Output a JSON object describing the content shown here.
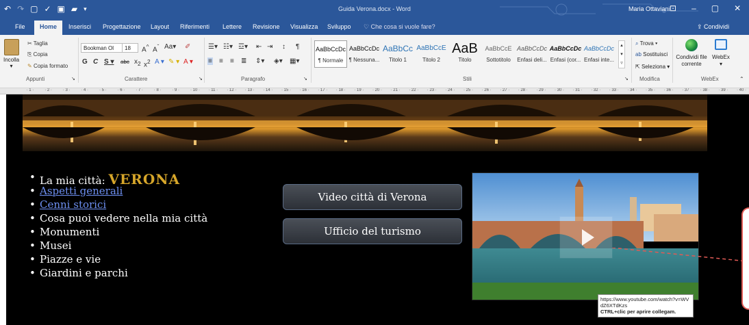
{
  "window": {
    "title": "Guida Verona.docx  -  Word",
    "user": "Maria Ottaviani"
  },
  "tabs": [
    "File",
    "Home",
    "Inserisci",
    "Progettazione",
    "Layout",
    "Riferimenti",
    "Lettere",
    "Revisione",
    "Visualizza",
    "Sviluppo"
  ],
  "tell_me": "Che cosa si vuole fare?",
  "share_label": "Condividi",
  "clipboard": {
    "paste": "Incolla",
    "cut": "Taglia",
    "copy": "Copia",
    "format_painter": "Copia formato",
    "group": "Appunti"
  },
  "font": {
    "name": "Bookman Ol",
    "size": "18",
    "group": "Carattere"
  },
  "paragraph_group": "Paragrafo",
  "styles": {
    "group": "Stili",
    "items": [
      {
        "sample": "AaBbCcDc",
        "name": "¶ Normale"
      },
      {
        "sample": "AaBbCcDc",
        "name": "¶ Nessuna..."
      },
      {
        "sample": "AaBbCc",
        "name": "Titolo 1"
      },
      {
        "sample": "AaBbCcE",
        "name": "Titolo 2"
      },
      {
        "sample": "AaB",
        "name": "Titolo"
      },
      {
        "sample": "AaBbCcE",
        "name": "Sottotitolo"
      },
      {
        "sample": "AaBbCcDc",
        "name": "Enfasi deli..."
      },
      {
        "sample": "AaBbCcDc",
        "name": "Enfasi (cor..."
      },
      {
        "sample": "AaBbCcDc",
        "name": "Enfasi inte..."
      }
    ]
  },
  "editing": {
    "find": "Trova",
    "replace": "Sostituisci",
    "select": "Seleziona",
    "group": "Modifica"
  },
  "webex": {
    "share_file": "Condividi file corrente",
    "webex": "WebEx",
    "group": "WebEx"
  },
  "document": {
    "bullet_prefix": "La mia città: ",
    "city": "VERONA",
    "links": [
      "Aspetti generali",
      "Cenni storici"
    ],
    "items": [
      "Cosa puoi vedere nella mia città",
      "Monumenti",
      "Musei",
      "Piazze e vie",
      "Giardini e parchi"
    ],
    "buttons": [
      "Video città di Verona",
      "Ufficio del turismo"
    ]
  },
  "tooltip": {
    "url": "https://www.youtube.com/watch?v=WVdZ6XTdKzs",
    "hint": "CTRL+clic per aprire collegam."
  }
}
